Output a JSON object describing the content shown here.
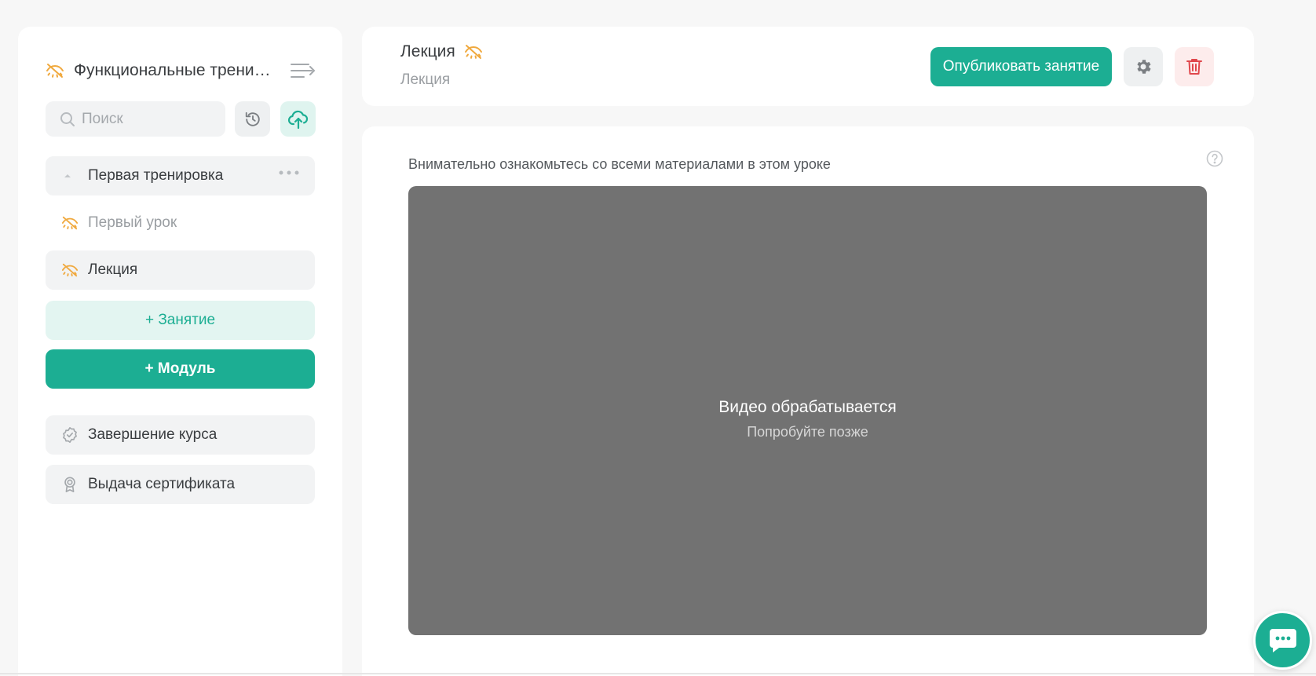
{
  "sidebar": {
    "course_title": "Функциональные трени…",
    "search_placeholder": "Поиск",
    "module": {
      "label": "Первая тренировка"
    },
    "lessons": [
      {
        "label": "Первый урок"
      },
      {
        "label": "Лекция"
      }
    ],
    "add_lesson_label": "+ Занятие",
    "add_module_label": "+ Модуль",
    "finish_course_label": "Завершение курса",
    "certificate_label": "Выдача сертификата"
  },
  "header": {
    "title": "Лекция",
    "subtitle": "Лекция",
    "publish_label": "Опубликовать занятие"
  },
  "content": {
    "instruction": "Внимательно ознакомьтесь со всеми материалами в этом уроке",
    "video_status": "Видео обрабатывается",
    "video_hint": "Попробуйте позже"
  },
  "colors": {
    "accent": "#1cae93",
    "accent_light": "#e3f5f1",
    "hidden_icon": "#f0a93e",
    "danger": "#e0474c",
    "video_bg": "#727272"
  },
  "icons": {
    "visibility": "eye-off-icon",
    "collapse": "collapse-menu-icon",
    "search": "search-icon",
    "history": "history-icon",
    "upload": "cloud-upload-icon",
    "settings": "gear-icon",
    "delete": "trash-icon",
    "help": "question-icon",
    "chat": "chat-icon"
  }
}
